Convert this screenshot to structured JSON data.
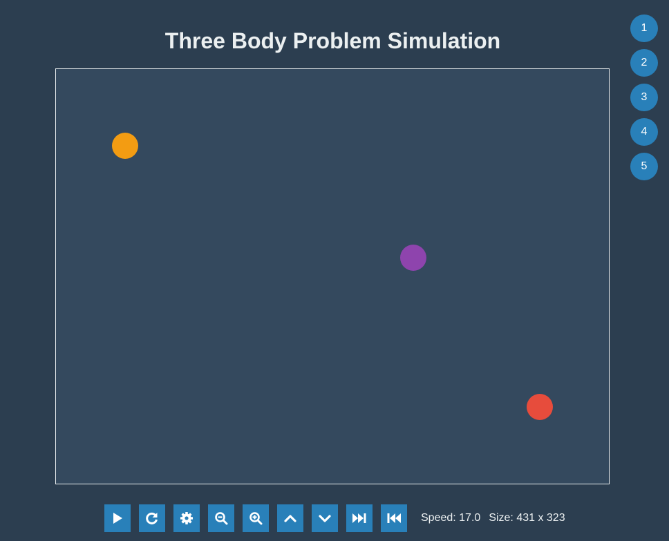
{
  "title": "Three Body Problem Simulation",
  "presets": [
    "1",
    "2",
    "3",
    "4",
    "5"
  ],
  "bodies": [
    {
      "name": "body-orange",
      "color": "#f39c12"
    },
    {
      "name": "body-purple",
      "color": "#8e44ad"
    },
    {
      "name": "body-red",
      "color": "#e74c3c"
    }
  ],
  "controls": [
    {
      "name": "play-button",
      "icon": "play-icon"
    },
    {
      "name": "reset-button",
      "icon": "reset-icon"
    },
    {
      "name": "settings-button",
      "icon": "gear-icon"
    },
    {
      "name": "zoom-out-button",
      "icon": "zoom-out-icon"
    },
    {
      "name": "zoom-in-button",
      "icon": "zoom-in-icon"
    },
    {
      "name": "speed-up-button",
      "icon": "chevron-up-icon"
    },
    {
      "name": "speed-down-button",
      "icon": "chevron-down-icon"
    },
    {
      "name": "fast-forward-button",
      "icon": "fast-forward-icon"
    },
    {
      "name": "rewind-button",
      "icon": "rewind-icon"
    }
  ],
  "status": {
    "speed": "Speed: 17.0",
    "size": "Size: 431 x 323"
  },
  "colors": {
    "background": "#2c3e50",
    "canvas": "#34495e",
    "accent": "#2980b9"
  }
}
